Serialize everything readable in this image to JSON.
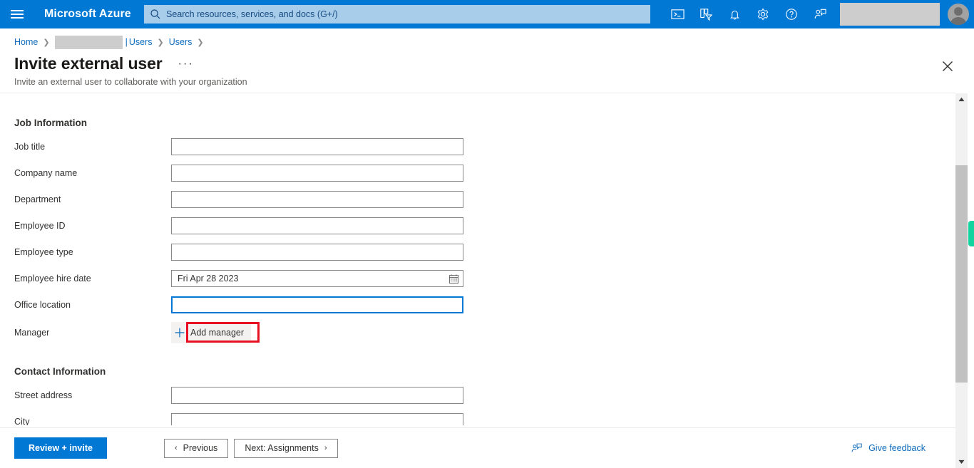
{
  "topbar": {
    "menu_icon": "hamburger-icon",
    "brand": "Microsoft Azure",
    "search_placeholder": "Search resources, services, and docs (G+/)",
    "search_value": "",
    "icons": [
      {
        "name": "cloud-shell-icon",
        "label": "Cloud Shell"
      },
      {
        "name": "directory-filter-icon",
        "label": "Directories + subscriptions"
      },
      {
        "name": "notifications-bell-icon",
        "label": "Notifications"
      },
      {
        "name": "settings-gear-icon",
        "label": "Settings"
      },
      {
        "name": "help-question-icon",
        "label": "Help"
      },
      {
        "name": "feedback-person-icon",
        "label": "Feedback"
      }
    ],
    "account_redacted": "",
    "avatar": "user-avatar"
  },
  "breadcrumb": {
    "home": "Home",
    "redacted_tenant": "",
    "pipe": "|",
    "item2": "Users",
    "item3": "Users"
  },
  "page": {
    "title": "Invite external user",
    "more_menu": "···",
    "subtitle": "Invite an external user to collaborate with your organization",
    "close_label": "Close"
  },
  "form": {
    "sections": [
      {
        "heading": "Job Information",
        "fields": [
          {
            "label": "Job title",
            "value": "",
            "type": "text"
          },
          {
            "label": "Company name",
            "value": "",
            "type": "text"
          },
          {
            "label": "Department",
            "value": "",
            "type": "text"
          },
          {
            "label": "Employee ID",
            "value": "",
            "type": "text"
          },
          {
            "label": "Employee type",
            "value": "",
            "type": "text"
          },
          {
            "label": "Employee hire date",
            "value": "Fri Apr 28 2023",
            "type": "date"
          },
          {
            "label": "Office location",
            "value": "",
            "type": "text",
            "focused": true
          },
          {
            "label": "Manager",
            "value": "Add manager",
            "type": "add-button",
            "highlighted": true
          }
        ]
      },
      {
        "heading": "Contact Information",
        "fields": [
          {
            "label": "Street address",
            "value": "",
            "type": "text"
          },
          {
            "label": "City",
            "value": "",
            "type": "text"
          }
        ]
      }
    ]
  },
  "footer": {
    "primary": "Review + invite",
    "previous": "Previous",
    "next": "Next: Assignments",
    "prev_chevron": "‹",
    "next_chevron": "›",
    "feedback": "Give feedback"
  },
  "scrollbar": {
    "up_arrow": "▲",
    "down_arrow": "▼",
    "position_marker": "green-cursor"
  },
  "colors": {
    "azure_blue": "#0078d4",
    "link_blue": "#0f6cbd",
    "highlight_red": "#e81123",
    "cursor_green": "#13d39e",
    "redact_gray": "#cdcdcd"
  }
}
